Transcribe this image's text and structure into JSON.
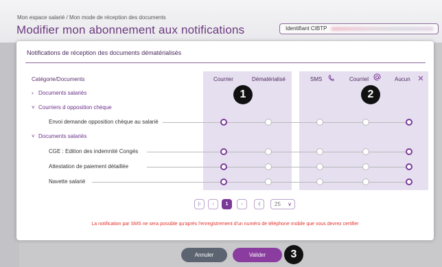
{
  "header": {
    "breadcrumb": "Mon espace salarié / Mon mode de réception des documents",
    "title": "Modifier mon abonnement aux notifications",
    "id_label": "Identifiant CIBTP"
  },
  "card": {
    "title": "Notifications de réception des documents dématérialisés",
    "category_header": "Catégorie/Documents",
    "columns": [
      "Courrier",
      "Dématérialisé",
      "SMS",
      "Courriel",
      "Aucun"
    ],
    "rows": [
      {
        "label": "Documents salariés",
        "kind": "group-collapsed",
        "selected": null
      },
      {
        "label": "Courriers d opposition chèque",
        "kind": "group-expanded",
        "selected": null
      },
      {
        "label": "Envoi demande opposition chèque au salarié",
        "kind": "item",
        "selected": [
          "Courrier",
          "Aucun"
        ]
      },
      {
        "label": "Documents salariés",
        "kind": "group-expanded",
        "selected": null
      },
      {
        "label": "CGE : Edition des indemnité Congés",
        "kind": "item",
        "selected": [
          "Courrier",
          "Aucun"
        ]
      },
      {
        "label": "Attestation de paiement détaillée",
        "kind": "item",
        "selected": [
          "Courrier",
          "Aucun"
        ]
      },
      {
        "label": "Navette salarié",
        "kind": "item",
        "selected": [
          "Courrier",
          "Aucun"
        ]
      }
    ],
    "badges": [
      "1",
      "2",
      "3"
    ],
    "pagination": {
      "current_page": "1",
      "page_size": "25"
    },
    "sms_note": "La notification par SMS ne sera possible qu'après l'enregistrement d'un numéro de téléphone mobile que vous devrez certifier"
  },
  "actions": {
    "cancel_label": "Annuler",
    "ok_label": "Valider"
  },
  "colors": {
    "accent": "#7a3a98",
    "panel": "#e6dff0",
    "title": "#6b3a7d",
    "warning": "#e0312b"
  },
  "icons": [
    "chevron-right-icon",
    "chevron-down-icon",
    "phone-icon",
    "at-icon",
    "close-icon",
    "first-page-icon",
    "prev-page-icon",
    "next-page-icon",
    "last-page-icon",
    "caret-down-icon"
  ]
}
